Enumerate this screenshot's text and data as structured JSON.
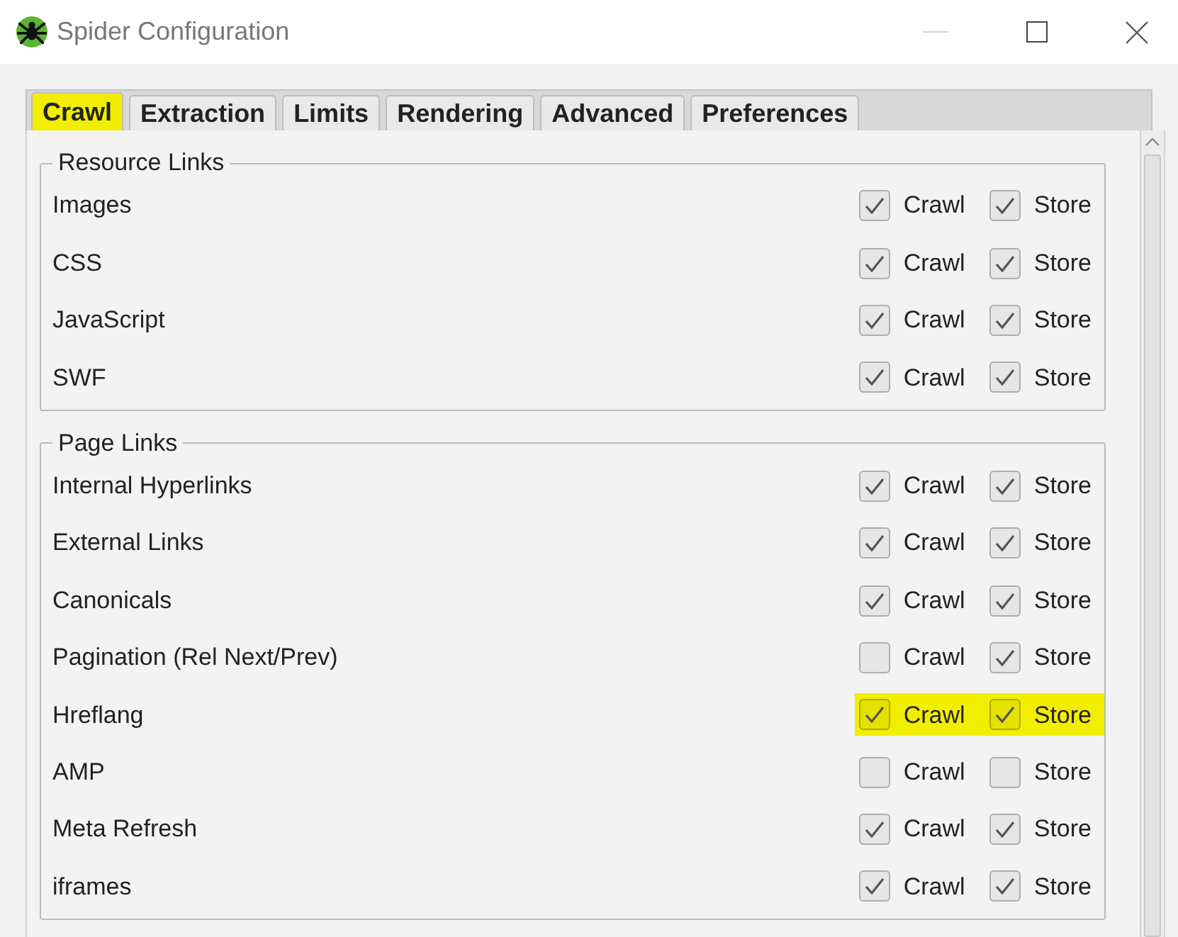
{
  "window": {
    "title": "Spider Configuration"
  },
  "tabs": [
    {
      "label": "Crawl",
      "selected": true,
      "highlighted": true
    },
    {
      "label": "Extraction",
      "selected": false,
      "highlighted": false
    },
    {
      "label": "Limits",
      "selected": false,
      "highlighted": false
    },
    {
      "label": "Rendering",
      "selected": false,
      "highlighted": false
    },
    {
      "label": "Advanced",
      "selected": false,
      "highlighted": false
    },
    {
      "label": "Preferences",
      "selected": false,
      "highlighted": false
    }
  ],
  "groups": [
    {
      "title": "Resource Links",
      "rows": [
        {
          "label": "Images",
          "highlighted": false,
          "options": [
            {
              "label": "Crawl",
              "checked": true
            },
            {
              "label": "Store",
              "checked": true
            }
          ]
        },
        {
          "label": "CSS",
          "highlighted": false,
          "options": [
            {
              "label": "Crawl",
              "checked": true
            },
            {
              "label": "Store",
              "checked": true
            }
          ]
        },
        {
          "label": "JavaScript",
          "highlighted": false,
          "options": [
            {
              "label": "Crawl",
              "checked": true
            },
            {
              "label": "Store",
              "checked": true
            }
          ]
        },
        {
          "label": "SWF",
          "highlighted": false,
          "options": [
            {
              "label": "Crawl",
              "checked": true
            },
            {
              "label": "Store",
              "checked": true
            }
          ]
        }
      ]
    },
    {
      "title": "Page Links",
      "rows": [
        {
          "label": "Internal Hyperlinks",
          "highlighted": false,
          "options": [
            {
              "label": "Crawl",
              "checked": true
            },
            {
              "label": "Store",
              "checked": true
            }
          ]
        },
        {
          "label": "External Links",
          "highlighted": false,
          "options": [
            {
              "label": "Crawl",
              "checked": true
            },
            {
              "label": "Store",
              "checked": true
            }
          ]
        },
        {
          "label": "Canonicals",
          "highlighted": false,
          "options": [
            {
              "label": "Crawl",
              "checked": true
            },
            {
              "label": "Store",
              "checked": true
            }
          ]
        },
        {
          "label": "Pagination (Rel Next/Prev)",
          "highlighted": false,
          "options": [
            {
              "label": "Crawl",
              "checked": false
            },
            {
              "label": "Store",
              "checked": true
            }
          ]
        },
        {
          "label": "Hreflang",
          "highlighted": true,
          "options": [
            {
              "label": "Crawl",
              "checked": true
            },
            {
              "label": "Store",
              "checked": true
            }
          ]
        },
        {
          "label": "AMP",
          "highlighted": false,
          "options": [
            {
              "label": "Crawl",
              "checked": false
            },
            {
              "label": "Store",
              "checked": false
            }
          ]
        },
        {
          "label": "Meta Refresh",
          "highlighted": false,
          "options": [
            {
              "label": "Crawl",
              "checked": true
            },
            {
              "label": "Store",
              "checked": true
            }
          ]
        },
        {
          "label": "iframes",
          "highlighted": false,
          "options": [
            {
              "label": "Crawl",
              "checked": true
            },
            {
              "label": "Store",
              "checked": true
            }
          ]
        }
      ]
    }
  ]
}
